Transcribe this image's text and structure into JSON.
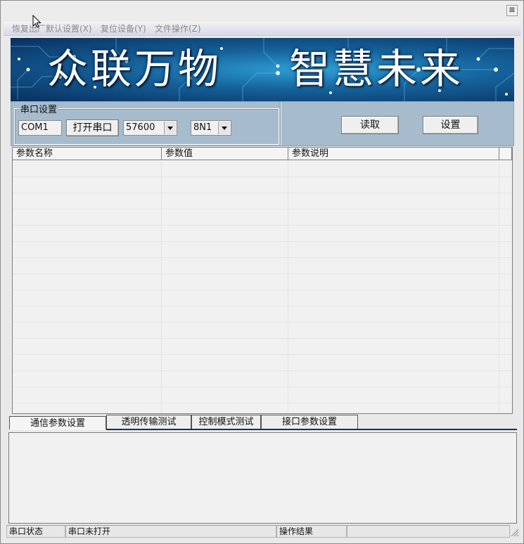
{
  "window": {
    "close_glyph": "⊠"
  },
  "menu": {
    "items": [
      "恢复出厂",
      "默认设置(X)",
      "复位设备(Y)",
      "文件操作(Z)"
    ]
  },
  "banner": {
    "left_text": "众联万物",
    "right_text": "智慧未来",
    "colors": {
      "dark": "#0a2e5c",
      "mid": "#15619a",
      "light": "#2f9fd6"
    }
  },
  "serial_settings": {
    "group_title": "串口设置",
    "port_value": "COM1",
    "open_button": "打开串口",
    "baud_value": "57600",
    "format_value": "8N1"
  },
  "actions": {
    "read_button": "读取",
    "set_button": "设置"
  },
  "table": {
    "columns": [
      "参数名称",
      "参数值",
      "参数说明"
    ],
    "rows": []
  },
  "tabs": [
    "通信参数设置",
    "透明传输测试",
    "控制模式测试",
    "接口参数设置"
  ],
  "active_tab": 0,
  "statusbar": {
    "label1": "串口状态",
    "value1": "串口未打开",
    "label2": "操作结果",
    "value2": ""
  }
}
